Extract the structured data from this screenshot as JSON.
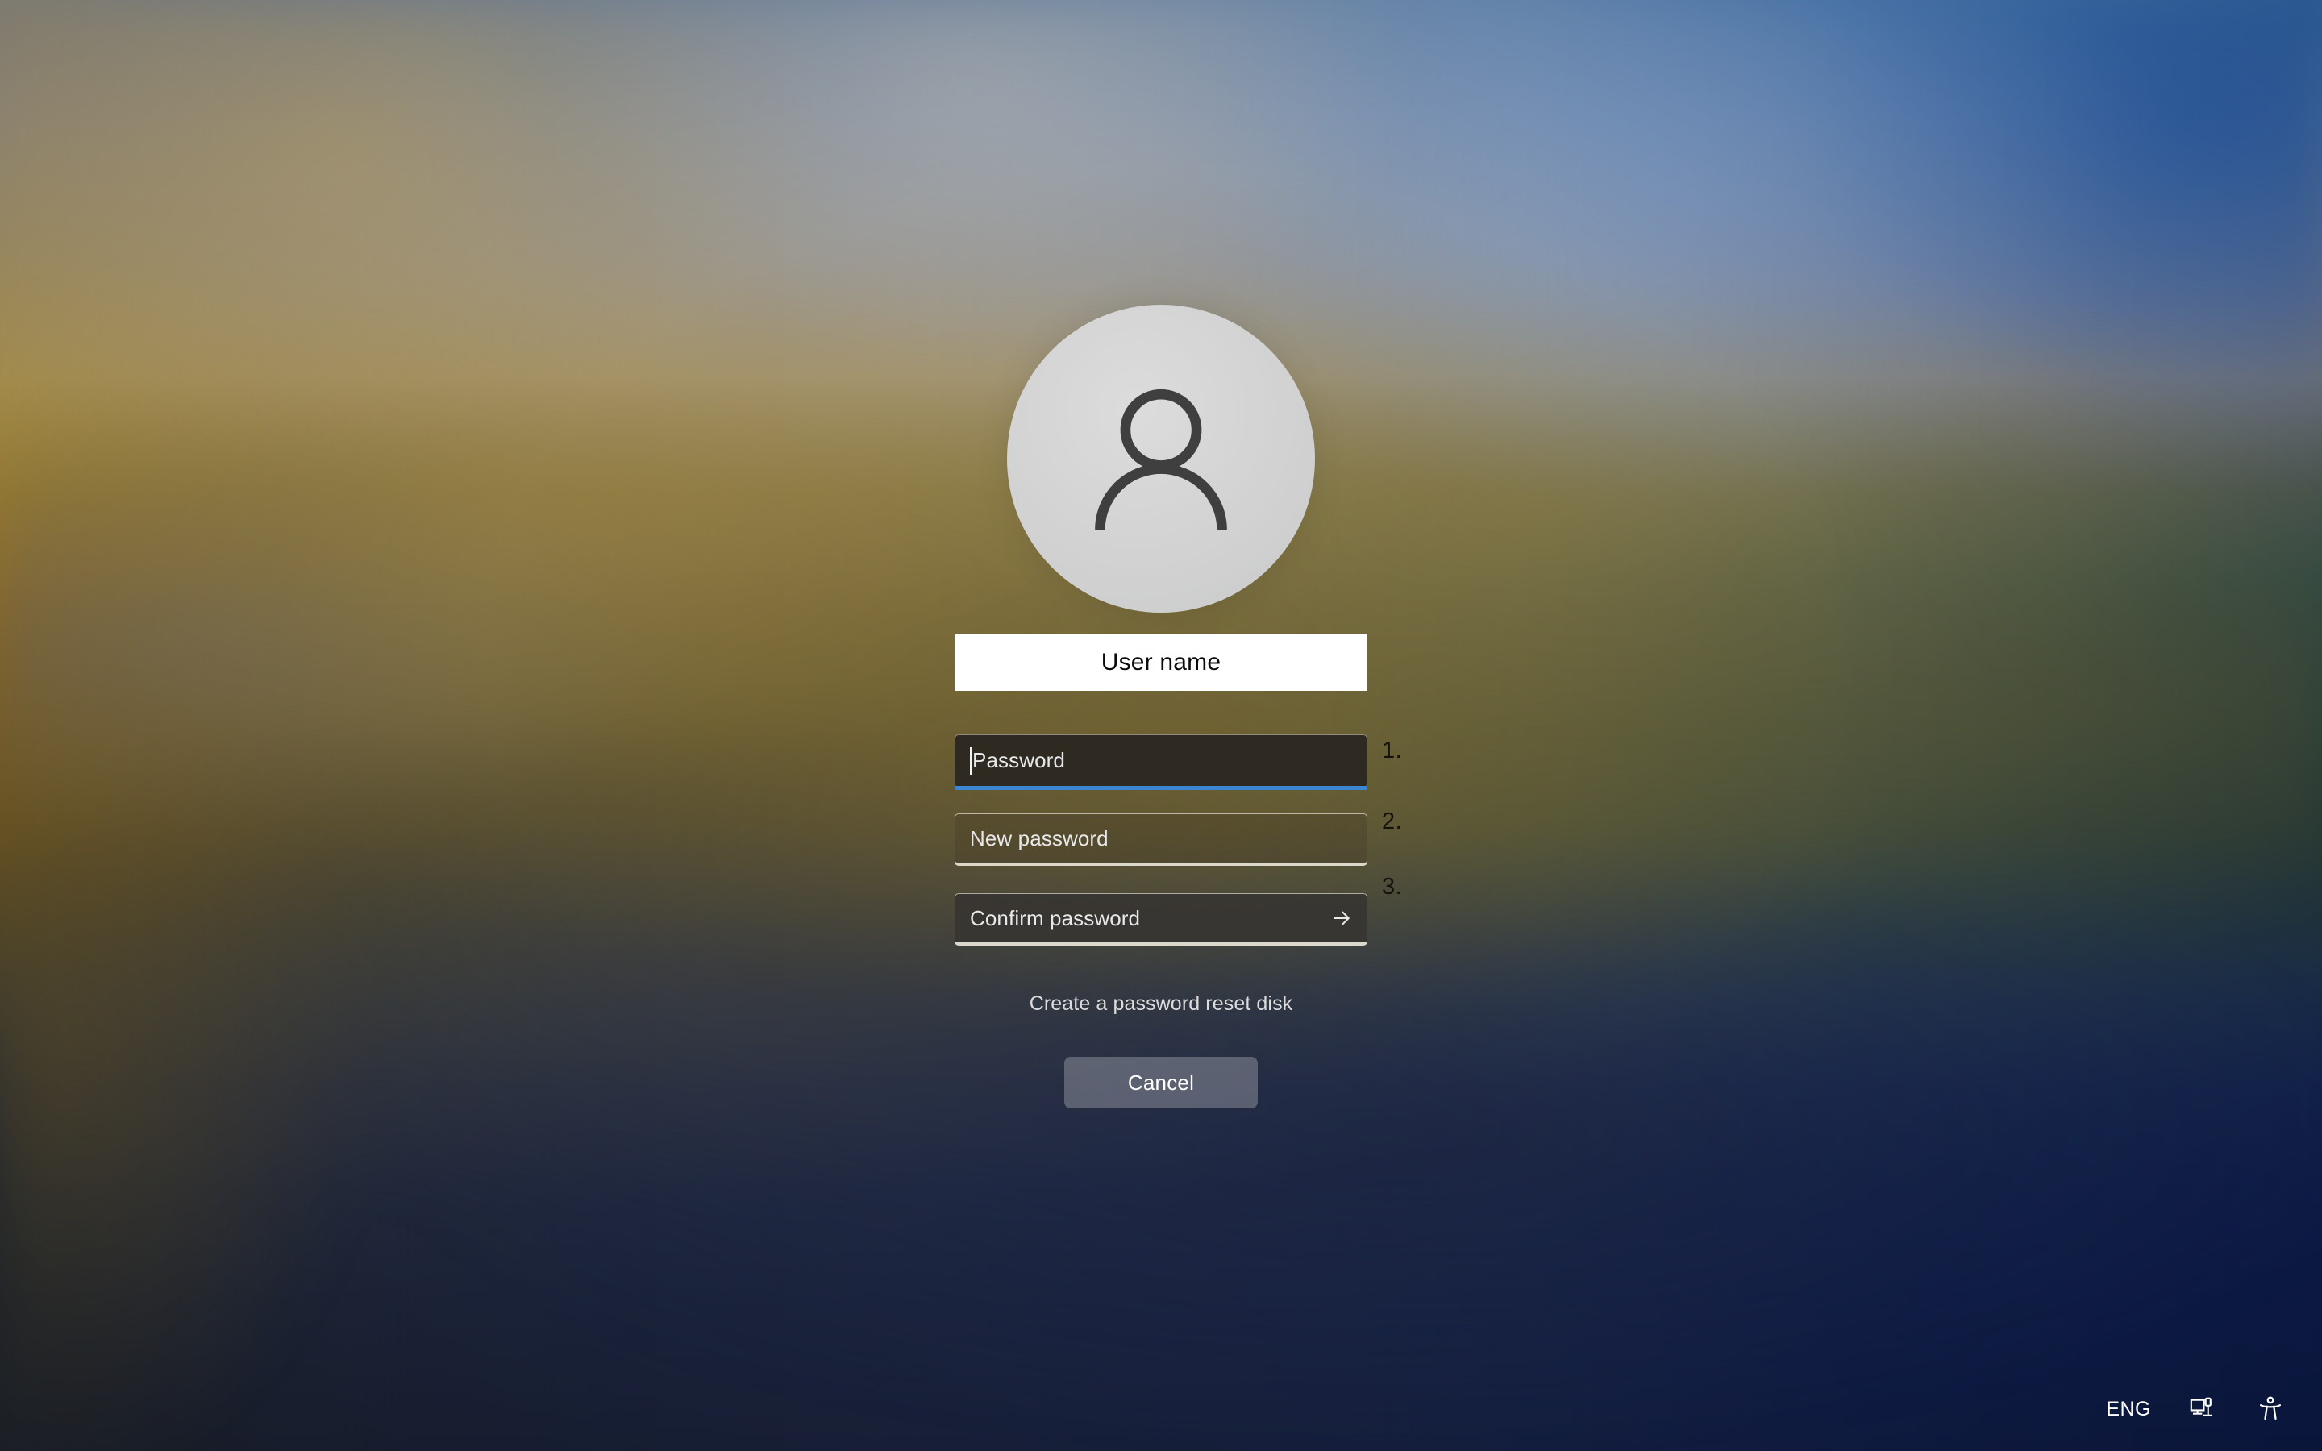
{
  "screen": {
    "kind": "windows-lock-screen-change-password",
    "background_description": "blurred desktop wallpaper"
  },
  "colors": {
    "accent_blue": "#3a86d4",
    "username_box_bg": "#ffffff",
    "username_text": "#0b0b0b",
    "placeholder_text": "#e8e8e8",
    "step_number_text": "#15120c",
    "link_text": "#dcdcdc",
    "cancel_button_bg": "rgba(158,160,170,0.46)",
    "cancel_button_text": "#ffffff",
    "avatar_circle": "#d2d2d2",
    "avatar_glyph": "#3f3f3f",
    "tray_icon": "#ffffff"
  },
  "account": {
    "avatar_icon": "user-person-icon",
    "username": "User name"
  },
  "form": {
    "fields": [
      {
        "name": "current-password",
        "placeholder": "Password",
        "value": "",
        "state": "focused",
        "has_caret": true,
        "step_label": "1."
      },
      {
        "name": "new-password",
        "placeholder": "New password",
        "value": "",
        "state": "empty",
        "has_caret": false,
        "step_label": "2."
      },
      {
        "name": "confirm-password",
        "placeholder": "Confirm password",
        "value": "",
        "state": "empty",
        "has_caret": false,
        "step_label": "3.",
        "submit_icon": "arrow-right-icon"
      }
    ],
    "reset_disk_link": "Create a password reset disk",
    "cancel_label": "Cancel"
  },
  "tray": {
    "language": "ENG",
    "items": [
      {
        "name": "language-indicator",
        "label": "ENG"
      },
      {
        "name": "network-icon",
        "label": "network-monitor-icon"
      },
      {
        "name": "accessibility-icon",
        "label": "ease-of-access-icon"
      }
    ]
  }
}
